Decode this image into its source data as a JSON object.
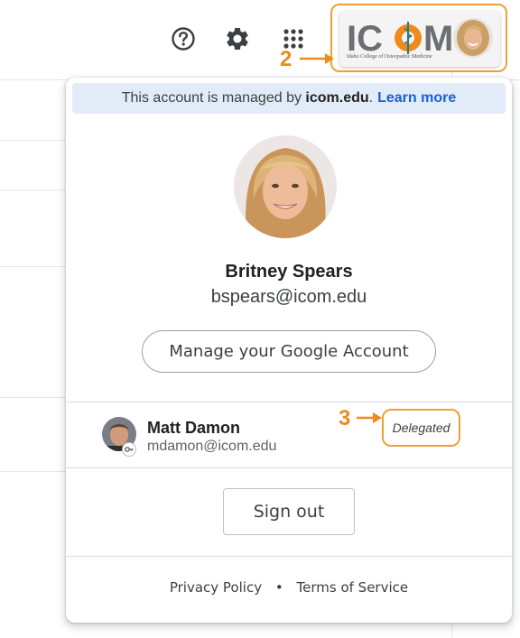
{
  "header": {
    "icons": [
      "help-circle-icon",
      "settings-gear-icon",
      "apps-grid-icon"
    ],
    "account_chip": {
      "logo_text": "ICOM",
      "logo_subtitle": "Idaho College of Osteopathic Medicine"
    }
  },
  "callouts": {
    "step_2": "2",
    "step_3": "3"
  },
  "popup": {
    "banner": {
      "prefix": "This account is managed by ",
      "domain": "icom.edu",
      "separator": ".",
      "link": "Learn more"
    },
    "profile": {
      "name": "Britney Spears",
      "email": "bspears@icom.edu"
    },
    "manage_button": "Manage your Google Account",
    "delegated_account": {
      "name": "Matt Damon",
      "email": "mdamon@icom.edu",
      "badge": "Delegated"
    },
    "sign_out": "Sign out",
    "footer": {
      "privacy": "Privacy Policy",
      "separator": "•",
      "terms": "Terms of Service"
    }
  },
  "colors": {
    "callout_orange": "#f08a1a",
    "banner_bg": "#e2ecf9",
    "link_blue": "#1a5fd6",
    "logo_teal": "#2d7f7a"
  }
}
